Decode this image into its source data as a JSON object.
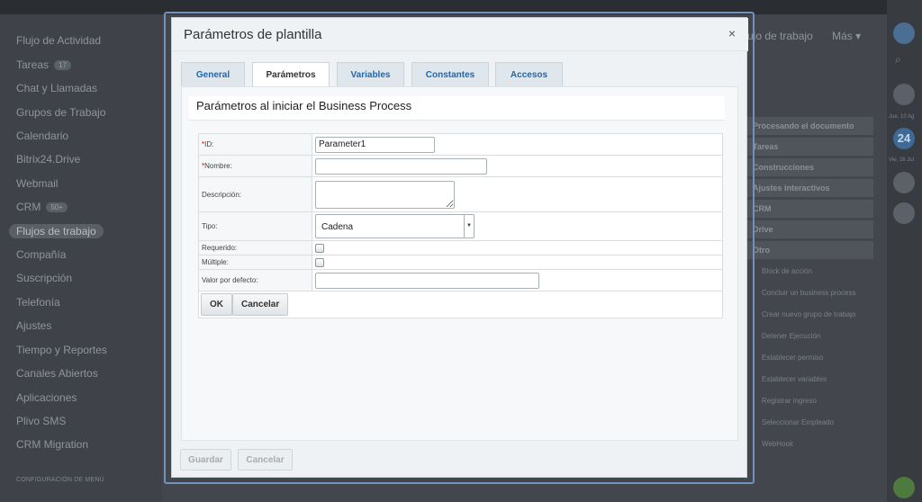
{
  "background": {
    "left_menu": [
      {
        "label": "Flujo de Actividad"
      },
      {
        "label": "Tareas",
        "count": "17"
      },
      {
        "label": "Chat y Llamadas"
      },
      {
        "label": "Grupos de Trabajo"
      },
      {
        "label": "Calendario"
      },
      {
        "label": "Bitrix24.Drive"
      },
      {
        "label": "Webmail"
      },
      {
        "label": "CRM",
        "count": "50+"
      },
      {
        "label": "Flujos de trabajo",
        "active": true
      },
      {
        "label": "Compañía"
      },
      {
        "label": "Suscripción"
      },
      {
        "label": "Telefonía"
      },
      {
        "label": "Ajustes"
      },
      {
        "label": "Tiempo y Reportes"
      },
      {
        "label": "Canales Abiertos"
      },
      {
        "label": "Aplicaciones"
      },
      {
        "label": "Plivo SMS"
      },
      {
        "label": "CRM Migration"
      }
    ],
    "config_label": "CONFIGURACIÓN DE MENÚ",
    "top_nav": [
      "ujo de trabajo",
      "Más ▾"
    ],
    "right_groups": [
      "Procesando el documento",
      "Tareas",
      "Construcciones",
      "Ajustes interactivos",
      "CRM",
      "Drive",
      "Otro"
    ],
    "right_actions": [
      "Block de acción",
      "Concluir un business process",
      "Crear nuevo grupo de trabajo",
      "Detener Ejecución",
      "Establecer permiso",
      "Establecer variables",
      "Registrar ingreso",
      "Seleccionar Empleado",
      "WebHook"
    ],
    "rail": {
      "date1": "Jue, 10 Ag",
      "calendar_day": "24",
      "date2": "Vie, 28 Jul"
    }
  },
  "modal": {
    "title": "Parámetros de plantilla",
    "close_glyph": "×",
    "tabs": [
      "General",
      "Parámetros",
      "Variables",
      "Constantes",
      "Accesos"
    ],
    "active_tab": "Parámetros",
    "section_title": "Parámetros al iniciar el Business Process",
    "form": {
      "id_label": "ID:",
      "id_value": "Parameter1",
      "name_label": "Nombre:",
      "name_value": "",
      "description_label": "Descripción:",
      "type_label": "Tipo:",
      "type_value": "Cadena",
      "required_label": "Requerido:",
      "multiple_label": "Múltiple:",
      "default_label": "Valor por defecto:",
      "default_value": "",
      "ok_label": "OK",
      "cancel_label": "Cancelar"
    },
    "footer": {
      "save_label": "Guardar",
      "cancel_label": "Cancelar"
    }
  },
  "colors": {
    "tab_text": "#2067b0",
    "modal_border": "#6f93bf",
    "required_marker": "#cc0000"
  }
}
